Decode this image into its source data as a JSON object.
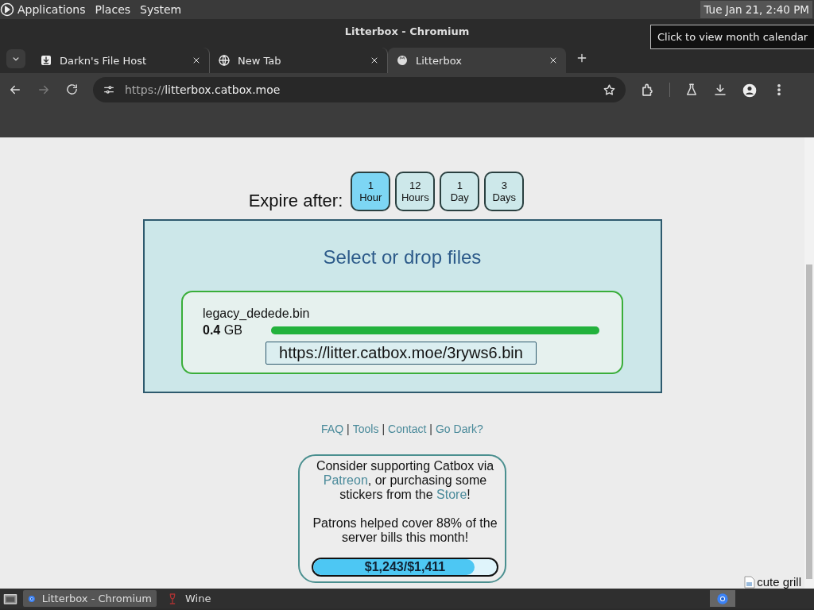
{
  "panel": {
    "menus": [
      "Applications",
      "Places",
      "System"
    ],
    "clock": "Tue Jan 21, 2:40 PM",
    "tooltip": "Click to view month calendar"
  },
  "window": {
    "title": "Litterbox - Chromium"
  },
  "tabs": [
    {
      "label": "Darkn's File Host",
      "kind": "download",
      "selected": false
    },
    {
      "label": "New Tab",
      "kind": "globe",
      "selected": false
    },
    {
      "label": "Litterbox",
      "kind": "cat",
      "selected": true
    }
  ],
  "address": {
    "scheme": "https://",
    "host": "litterbox.catbox.moe"
  },
  "expire": {
    "label": "Expire after:",
    "options": [
      {
        "number": "1",
        "unit": "Hour",
        "selected": true
      },
      {
        "number": "12",
        "unit": "Hours",
        "selected": false
      },
      {
        "number": "1",
        "unit": "Day",
        "selected": false
      },
      {
        "number": "3",
        "unit": "Days",
        "selected": false
      }
    ]
  },
  "upload": {
    "title": "Select or drop files",
    "file": {
      "name": "legacy_dedede.bin",
      "size": "**0.4** GB",
      "level": 1,
      "url": "https://litter.catbox.moe/3ryws6.bin"
    }
  },
  "footer": {
    "links": [
      "FAQ",
      "Tools",
      "Contact",
      "Go Dark?"
    ],
    "separator": "|"
  },
  "support": {
    "paragraph_1": [
      {
        "text": "Consider supporting Catbox via "
      },
      {
        "link": "Patreon"
      },
      {
        "text": ", or purchasing some stickers from the "
      },
      {
        "link": "Store"
      },
      {
        "text": "!"
      }
    ],
    "paragraph_2": "Patrons helped cover 88% of the server bills this month!",
    "progress": {
      "label": "$1,243/$1,411",
      "level": 0.88
    }
  },
  "broken_image": {
    "alt": "cute grill"
  },
  "taskbar": [
    {
      "label": "Litterbox - Chromium",
      "kind": "chromium",
      "selected": true
    },
    {
      "label": "Wine",
      "kind": "wine",
      "selected": false
    }
  ]
}
